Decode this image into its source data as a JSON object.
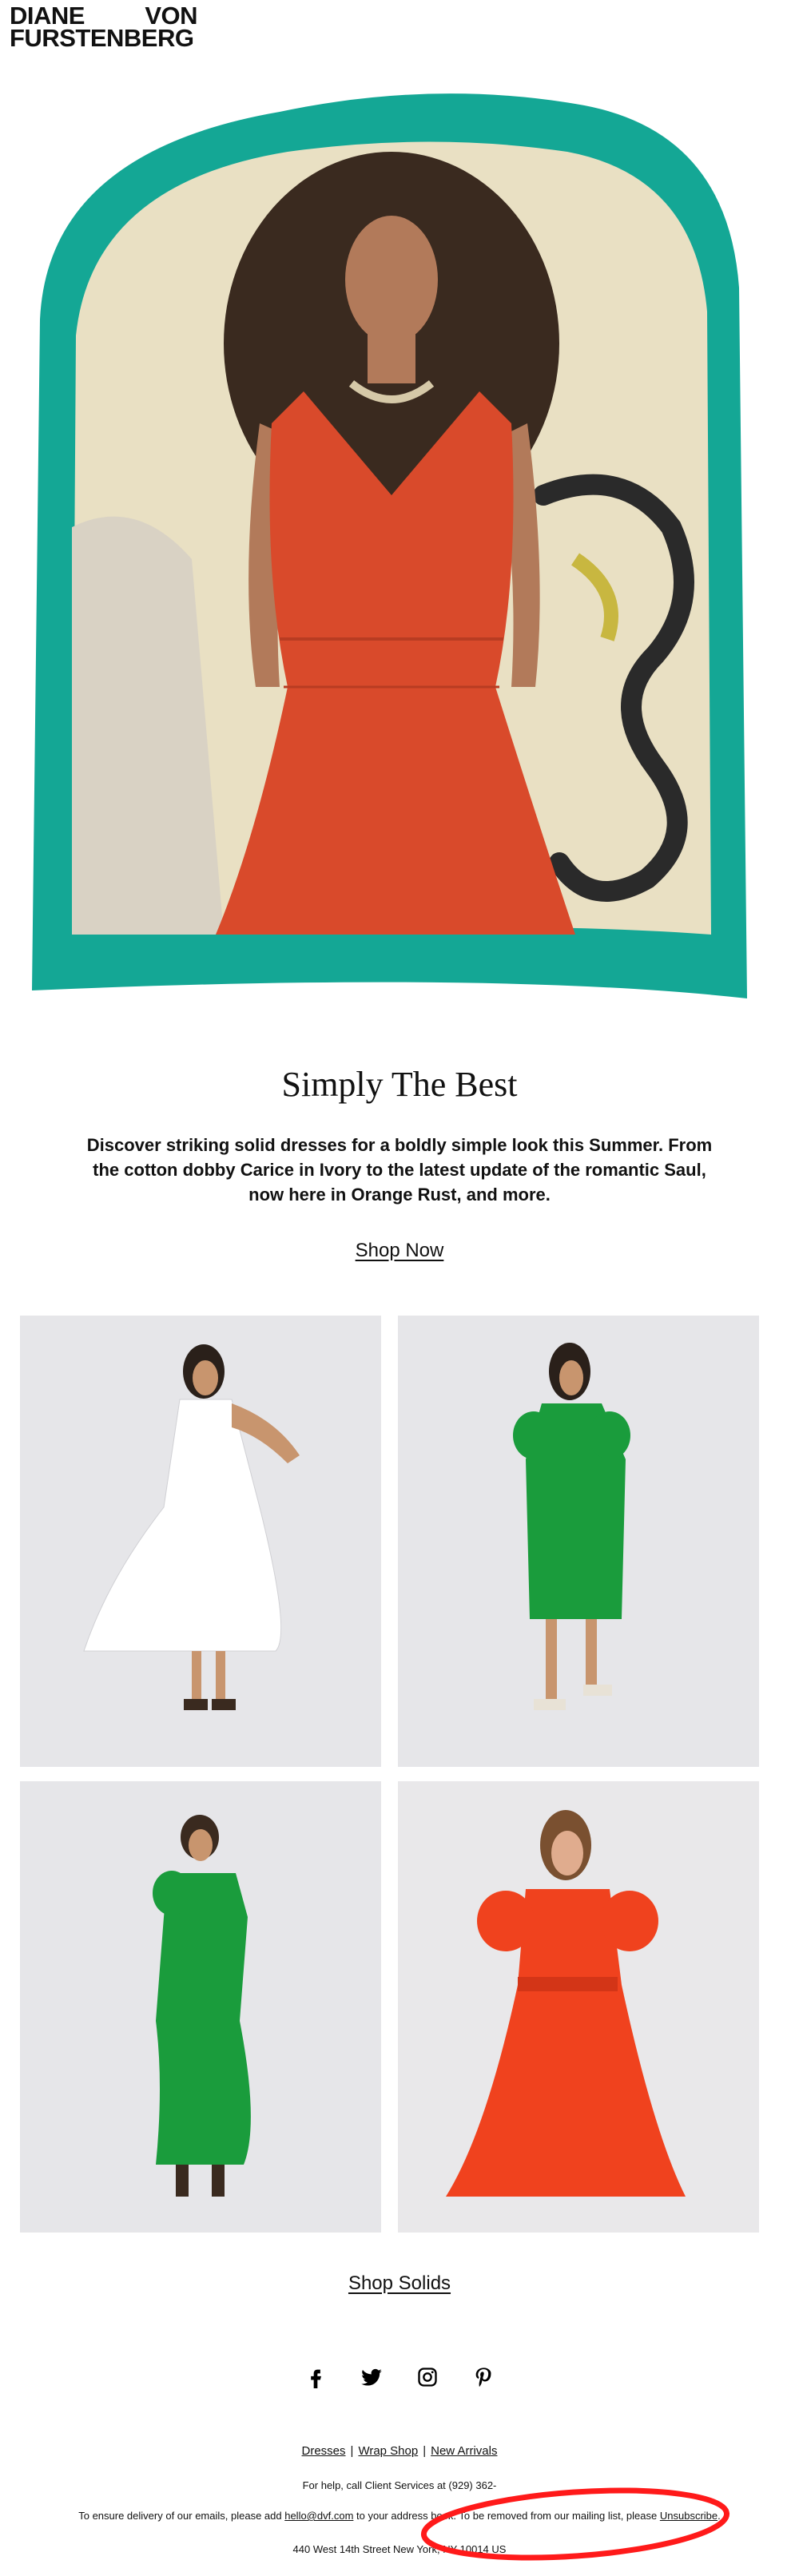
{
  "brand": {
    "line1_left": "DIANE",
    "line1_right": "VON",
    "line2": "FURSTENBERG"
  },
  "hero": {
    "frame_color": "#14a795",
    "dress_color": "#d94a2b"
  },
  "headline": "Simply The Best",
  "subcopy": "Discover striking solid dresses for a boldly simple look this Summer. From the cotton dobby Carice in Ivory to the latest update of the romantic Saul, now here in Orange Rust, and more.",
  "cta_primary": "Shop Now",
  "products": [
    {
      "color": "#ffffff"
    },
    {
      "color": "#1a9c3c"
    },
    {
      "color": "#1a9c3c"
    },
    {
      "color": "#f0421e"
    }
  ],
  "cta_secondary": "Shop Solids",
  "social": [
    "facebook-icon",
    "twitter-icon",
    "instagram-icon",
    "pinterest-icon"
  ],
  "footer": {
    "links": [
      "Dresses",
      "Wrap Shop",
      "New Arrivals"
    ],
    "separator": "|",
    "help_text": "For help, call Client Services at (929) 362-",
    "deliver_prefix": "To ensure delivery of our emails, please add ",
    "deliver_email": "hello@dvf.com",
    "deliver_middle": " to your address book. To be removed from our mailing list, please ",
    "deliver_unsub": "Unsubscribe",
    "deliver_suffix": ".",
    "address": "440 West 14th Street New York, NY 10014 US"
  },
  "annotation_color": "#ff1a1a"
}
